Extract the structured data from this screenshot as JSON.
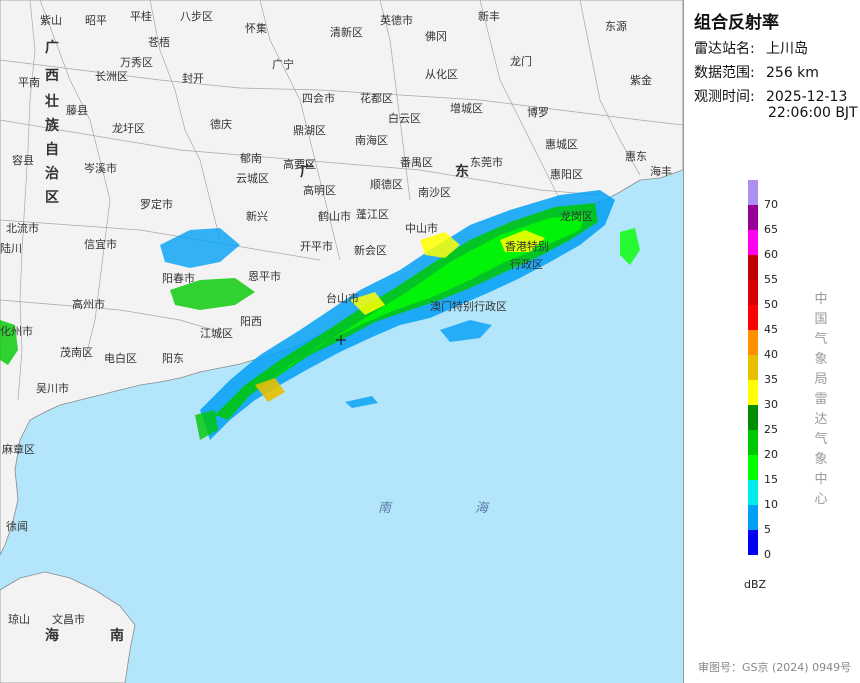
{
  "panel": {
    "title": "组合反射率",
    "station_key": "雷达站名:",
    "station_val": "上川岛",
    "range_key": "数据范围:",
    "range_val": "256 km",
    "time_key": "观测时间:",
    "time_date": "2025-12-13",
    "time_clock": "22:06:00 BJT",
    "unit": "dBZ",
    "vertical_text": [
      "中",
      "国",
      "气",
      "象",
      "局",
      "雷",
      "达",
      "气",
      "象",
      "中",
      "心"
    ],
    "approval": "审图号：GS京 (2024) 0949号"
  },
  "legend": {
    "labels": [
      "70",
      "65",
      "60",
      "55",
      "50",
      "45",
      "40",
      "35",
      "30",
      "25",
      "20",
      "15",
      "10",
      "5",
      "0"
    ],
    "colors": [
      "#ad90f0",
      "#960096",
      "#ff00f0",
      "#c00000",
      "#d60000",
      "#ff0000",
      "#ff9000",
      "#e7c000",
      "#ffff00",
      "#008e00",
      "#00c800",
      "#01ff00",
      "#00ecec",
      "#01a0f6",
      "#0000f6"
    ]
  },
  "map": {
    "colors": {
      "land": "#f3f3f3",
      "sea": "#b3e5fb",
      "border": "#9a9a9a"
    },
    "cities": [
      {
        "name": "紫山",
        "cls": "s"
      },
      {
        "name": "昭平",
        "cls": "s"
      },
      {
        "name": "平桂",
        "cls": "s"
      },
      {
        "name": "八步区",
        "cls": "s"
      },
      {
        "name": "怀集",
        "cls": "s"
      },
      {
        "name": "清新区",
        "cls": "s"
      },
      {
        "name": "英德市",
        "cls": "s"
      },
      {
        "name": "新丰",
        "cls": "s"
      },
      {
        "name": "佛冈",
        "cls": "s"
      },
      {
        "name": "东源",
        "cls": "s"
      },
      {
        "name": "苍梧",
        "cls": "s"
      },
      {
        "name": "万秀区",
        "cls": "s"
      },
      {
        "name": "长洲区",
        "cls": "s"
      },
      {
        "name": "封开",
        "cls": "s"
      },
      {
        "name": "广宁",
        "cls": "s"
      },
      {
        "name": "从化区",
        "cls": "s"
      },
      {
        "name": "龙门",
        "cls": "s"
      },
      {
        "name": "紫金",
        "cls": "s"
      },
      {
        "name": "平南",
        "cls": "s"
      },
      {
        "name": "藤县",
        "cls": "s"
      },
      {
        "name": "四会市",
        "cls": "s"
      },
      {
        "name": "花都区",
        "cls": "s"
      },
      {
        "name": "白云区",
        "cls": "s"
      },
      {
        "name": "增城区",
        "cls": "s"
      },
      {
        "name": "博罗",
        "cls": "s"
      },
      {
        "name": "龙圩区",
        "cls": "s"
      },
      {
        "name": "德庆",
        "cls": "s"
      },
      {
        "name": "鼎湖区",
        "cls": "s"
      },
      {
        "name": "南海区",
        "cls": "s"
      },
      {
        "name": "惠城区",
        "cls": "s"
      },
      {
        "name": "容县",
        "cls": "s"
      },
      {
        "name": "郁南",
        "cls": "s"
      },
      {
        "name": "番禺区",
        "cls": "s"
      },
      {
        "name": "东莞市",
        "cls": "s"
      },
      {
        "name": "惠东",
        "cls": "s"
      },
      {
        "name": "岑溪市",
        "cls": "s"
      },
      {
        "name": "云城区",
        "cls": "s"
      },
      {
        "name": "高要区",
        "cls": "s"
      },
      {
        "name": "高明区",
        "cls": "s"
      },
      {
        "name": "顺德区",
        "cls": "s"
      },
      {
        "name": "南沙区",
        "cls": "s"
      },
      {
        "name": "惠阳区",
        "cls": "s"
      },
      {
        "name": "海丰",
        "cls": "s"
      },
      {
        "name": "罗定市",
        "cls": "s"
      },
      {
        "name": "新兴",
        "cls": "s"
      },
      {
        "name": "鹤山市",
        "cls": "s"
      },
      {
        "name": "蓬江区",
        "cls": "s"
      },
      {
        "name": "中山市",
        "cls": "s"
      },
      {
        "name": "龙岗区",
        "cls": "s"
      },
      {
        "name": "北流市",
        "cls": "s"
      },
      {
        "name": "信宜市",
        "cls": "s"
      },
      {
        "name": "开平市",
        "cls": "s"
      },
      {
        "name": "新会区",
        "cls": "s"
      },
      {
        "name": "香港特别",
        "cls": "s"
      },
      {
        "name": "行政区",
        "cls": "s"
      },
      {
        "name": "阳春市",
        "cls": "s"
      },
      {
        "name": "恩平市",
        "cls": "s"
      },
      {
        "name": "台山市",
        "cls": "s"
      },
      {
        "name": "澳门特别行政区",
        "cls": "s"
      },
      {
        "name": "高州市",
        "cls": "s"
      },
      {
        "name": "阳西",
        "cls": "s"
      },
      {
        "name": "江城区",
        "cls": "s"
      },
      {
        "name": "化州市",
        "cls": "s"
      },
      {
        "name": "茂南区",
        "cls": "s"
      },
      {
        "name": "电白区",
        "cls": "s"
      },
      {
        "name": "阳东",
        "cls": "s"
      },
      {
        "name": "吴川市",
        "cls": "s"
      },
      {
        "name": "麻章区",
        "cls": "s"
      },
      {
        "name": "文昌市",
        "cls": "s"
      },
      {
        "name": "陆川",
        "cls": "s"
      },
      {
        "name": "徐闻",
        "cls": "s"
      },
      {
        "name": "琼山",
        "cls": "s"
      }
    ],
    "region_labels": [
      "广",
      "西",
      "壮",
      "族",
      "自",
      "治",
      "区",
      "广",
      "东",
      "海",
      "南",
      "南",
      "海"
    ]
  }
}
